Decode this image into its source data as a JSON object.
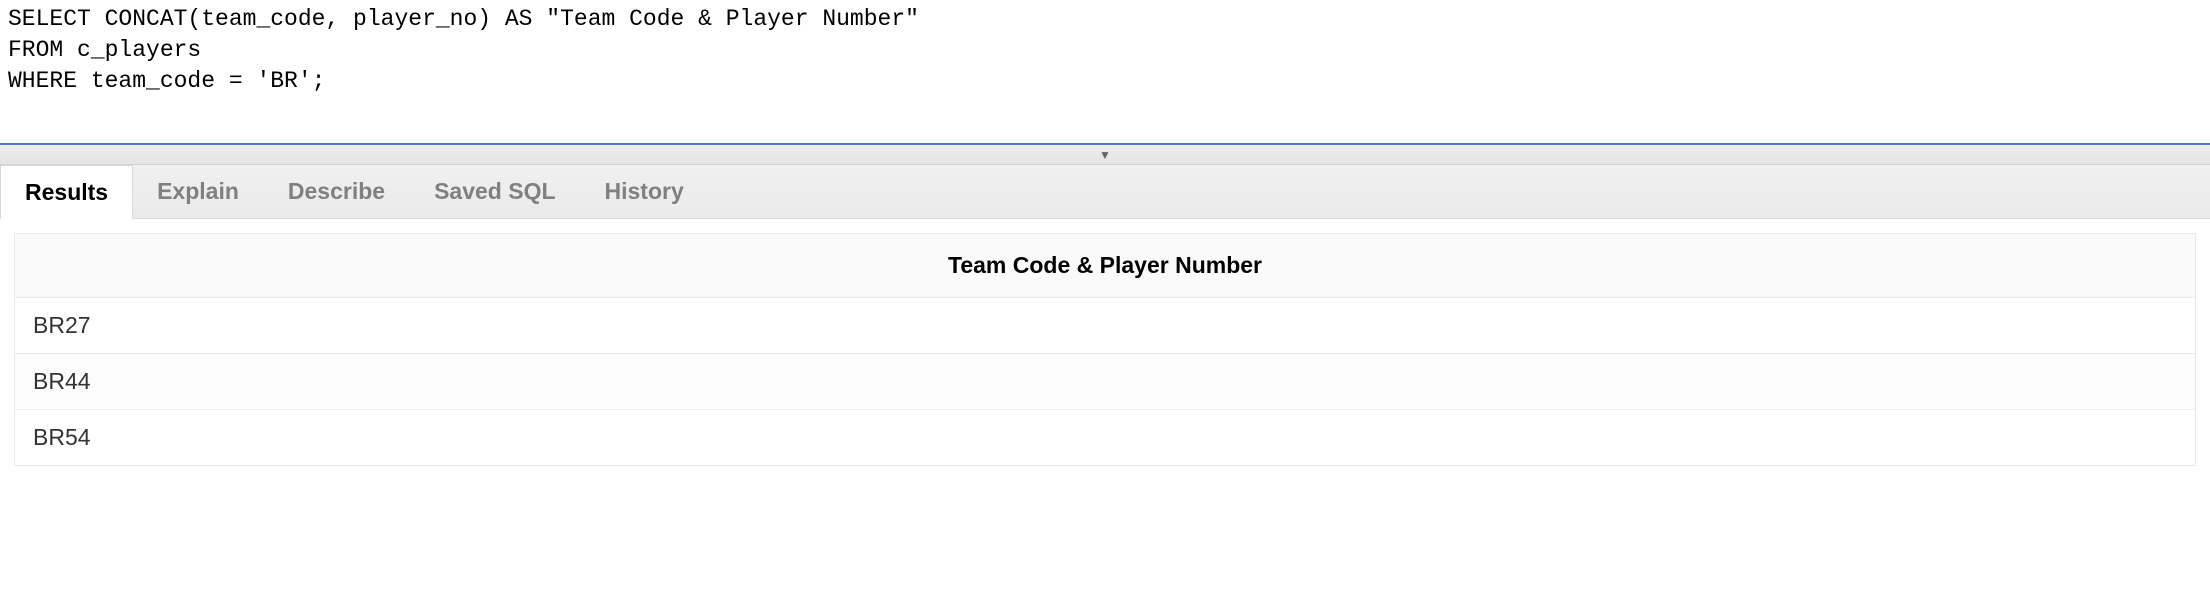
{
  "editor": {
    "sql": "SELECT CONCAT(team_code, player_no) AS \"Team Code & Player Number\"\nFROM c_players\nWHERE team_code = 'BR';"
  },
  "tabs": {
    "results": "Results",
    "explain": "Explain",
    "describe": "Describe",
    "saved_sql": "Saved SQL",
    "history": "History"
  },
  "results": {
    "columns": [
      "Team Code & Player Number"
    ],
    "rows": [
      [
        "BR27"
      ],
      [
        "BR44"
      ],
      [
        "BR54"
      ]
    ]
  }
}
